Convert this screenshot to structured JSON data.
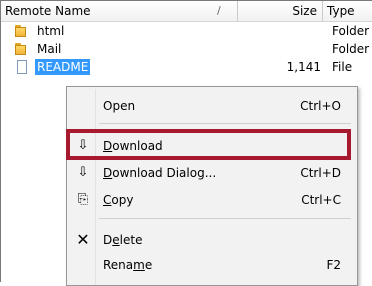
{
  "columns": {
    "name": "Remote Name",
    "sort_indicator": "/",
    "size": "Size",
    "type": "Type"
  },
  "files": [
    {
      "name": "html",
      "size": "",
      "type": "Folder",
      "icon": "folder-icon"
    },
    {
      "name": "Mail",
      "size": "",
      "type": "Folder",
      "icon": "folder-icon"
    },
    {
      "name": "README",
      "size": "1,141",
      "type": "File",
      "icon": "file-icon",
      "selected": true
    }
  ],
  "context_menu": {
    "items": [
      {
        "pre": "Open",
        "u": "",
        "post": "",
        "shortcut": "Ctrl+O",
        "icon": ""
      },
      {
        "pre": "",
        "u": "D",
        "post": "ownload",
        "shortcut": "",
        "icon": "download-icon",
        "highlighted": true
      },
      {
        "pre": "",
        "u": "D",
        "post": "ownload Dialog...",
        "shortcut": "Ctrl+D",
        "icon": "download-icon"
      },
      {
        "pre": "",
        "u": "C",
        "post": "opy",
        "shortcut": "Ctrl+C",
        "icon": "copy-icon"
      },
      {
        "pre": "D",
        "u": "e",
        "post": "lete",
        "shortcut": "",
        "icon": "delete-icon"
      },
      {
        "pre": "Rena",
        "u": "m",
        "post": "e",
        "shortcut": "F2",
        "icon": ""
      }
    ]
  },
  "colors": {
    "selection": "#3399ff",
    "highlight_border": "#a6192e",
    "delete_icon": "#000000"
  }
}
